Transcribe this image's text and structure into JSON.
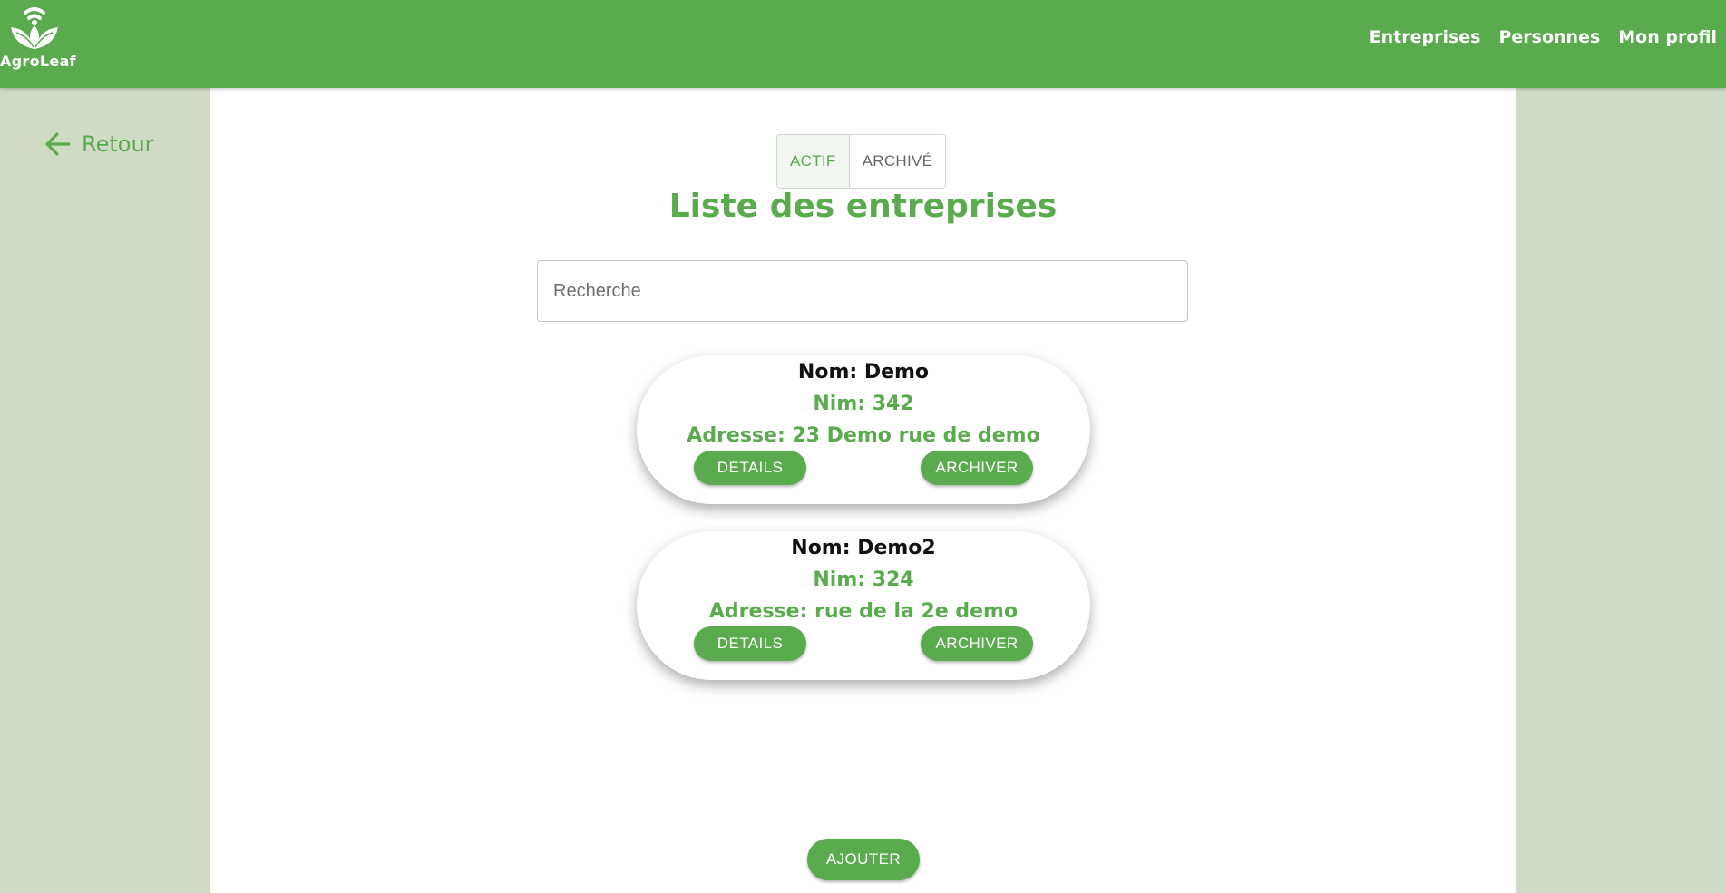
{
  "app": {
    "logo_text": "AgroLeaf",
    "brand_color": "#5aaa4e",
    "side_panel_color": "#d0dbc6"
  },
  "nav": {
    "items": [
      "Entreprises",
      "Personnes",
      "Mon profil"
    ]
  },
  "back": {
    "label": "Retour",
    "icon": "arrow-left-icon"
  },
  "toggle": {
    "options": [
      "ACTIF",
      "ARCHIVÉ"
    ],
    "selected": "ACTIF"
  },
  "page": {
    "title": "Liste des entreprises"
  },
  "search": {
    "placeholder": "Recherche",
    "value": ""
  },
  "companies": [
    {
      "nom": "Nom: Demo",
      "nim": "Nim: 342",
      "adresse": "Adresse: 23 Demo rue de demo",
      "details_label": "DETAILS",
      "archive_label": "ARCHIVER"
    },
    {
      "nom": "Nom: Demo2",
      "nim": "Nim: 324",
      "adresse": "Adresse: rue de la 2e demo",
      "details_label": "DETAILS",
      "archive_label": "ARCHIVER"
    }
  ],
  "actions": {
    "add_label": "AJOUTER"
  }
}
